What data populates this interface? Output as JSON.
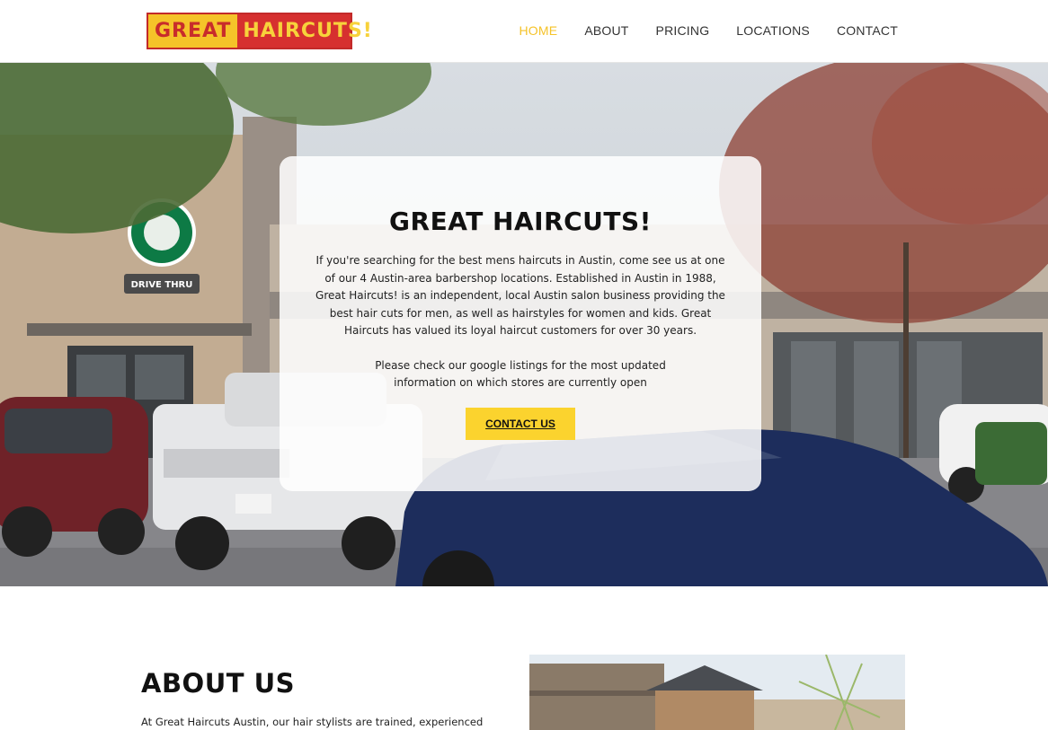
{
  "brand": {
    "logo_part1": "GREAT",
    "logo_part2": "HAIRCUTS!",
    "colors": {
      "accent": "#f5c329",
      "logo_red": "#d6302f",
      "button": "#fbd32e"
    }
  },
  "nav": {
    "items": [
      {
        "label": "HOME",
        "active": true
      },
      {
        "label": "ABOUT",
        "active": false
      },
      {
        "label": "PRICING",
        "active": false
      },
      {
        "label": "LOCATIONS",
        "active": false
      },
      {
        "label": "CONTACT",
        "active": false
      }
    ]
  },
  "hero": {
    "title": "GREAT HAIRCUTS!",
    "paragraph1": "If you're searching for the best mens haircuts in Austin, come see us at one of our 4 Austin-area barbershop locations. Established in Austin in 1988, Great Haircuts! is an independent, local Austin salon business providing the best hair cuts for men, as well as hairstyles for women and kids. Great Haircuts has valued its loyal haircut customers for over 30 years.",
    "paragraph2": "Please check our google listings for the most updated information on which stores are currently open",
    "cta_label": "CONTACT US",
    "photo_sign": "DRIVE THRU"
  },
  "about": {
    "title": "ABOUT US",
    "text": "At Great Haircuts Austin, our hair stylists are trained, experienced"
  }
}
